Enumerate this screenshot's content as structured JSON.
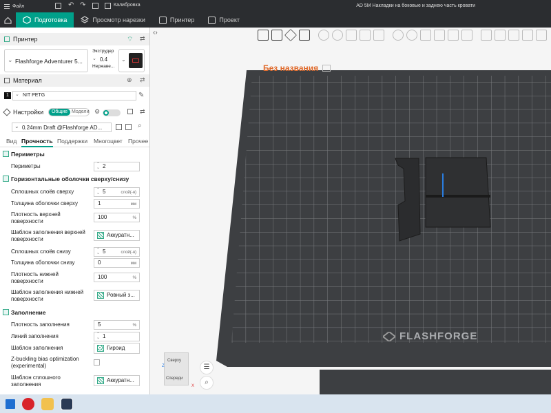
{
  "titlebar": {
    "file_label": "Файл",
    "calibration_label": "Калибровка",
    "window_title": "AD 5M Накладки на боковые и заднею часть кровати"
  },
  "tabs": [
    {
      "label": "Подготовка"
    },
    {
      "label": "Просмотр нарезки"
    },
    {
      "label": "Принтер"
    },
    {
      "label": "Проект"
    }
  ],
  "printer": {
    "section_label": "Принтер",
    "name": "Flashforge Adventurer 5...",
    "extruder_label": "Экструдер",
    "nozzle": "0.4",
    "nozzle_material": "Нержаве..."
  },
  "material": {
    "section_label": "Материал",
    "slot": "1",
    "filament": "NIT PETG"
  },
  "settings": {
    "section_label": "Настройки",
    "toggle_common": "Общие",
    "toggle_models": "Модели",
    "profile": "0.24mm Draft @Flashforge AD...",
    "subtabs": [
      "Вид",
      "Прочность",
      "Поддержки",
      "Многоцвет",
      "Прочее"
    ]
  },
  "groups": {
    "perimeters": "Периметры",
    "shells": "Горизонтальные оболочки сверху/снизу",
    "infill": "Заполнение"
  },
  "params": {
    "perimeters_label": "Периметры",
    "perimeters_value": "2",
    "top_layers_label": "Сплошных слоёв сверху",
    "top_layers_value": "5",
    "layers_unit": "слой(-я)",
    "top_thickness_label": "Толщина оболочки сверху",
    "top_thickness_value": "1",
    "mm_unit": "мм",
    "top_density_label": "Плотность верхней поверхности",
    "top_density_value": "100",
    "pct_unit": "%",
    "top_pattern_label": "Шаблон заполнения верхней поверхности",
    "top_pattern_value": "Аккуратн...",
    "bottom_layers_label": "Сплошных слоёв снизу",
    "bottom_layers_value": "5",
    "bottom_thickness_label": "Толщина оболочки снизу",
    "bottom_thickness_value": "0",
    "bottom_density_label": "Плотность нижней поверхности",
    "bottom_density_value": "100",
    "bottom_pattern_label": "Шаблон заполнения нижней поверхности",
    "bottom_pattern_value": "Ровный з...",
    "infill_density_label": "Плотность заполнения",
    "infill_density_value": "5",
    "infill_lines_label": "Линий заполнения",
    "infill_lines_value": "1",
    "infill_pattern_label": "Шаблон заполнения",
    "infill_pattern_value": "Гироид",
    "zbuckling_label": "Z-buckling bias optimization (experimental)",
    "solid_pattern_label": "Шаблон сплошного заполнения",
    "solid_pattern_value": "Аккуратн..."
  },
  "viewport": {
    "plate_name": "Без названия",
    "brand": "FLASHFORGE",
    "view_top": "Сверху",
    "view_front": "Спереди",
    "axis_x": "X",
    "axis_z": "Z"
  },
  "colors": {
    "accent": "#00a08a",
    "plate_name": "#e06a2b",
    "bed": "#3d3f42",
    "grid": "#7a7c80"
  }
}
